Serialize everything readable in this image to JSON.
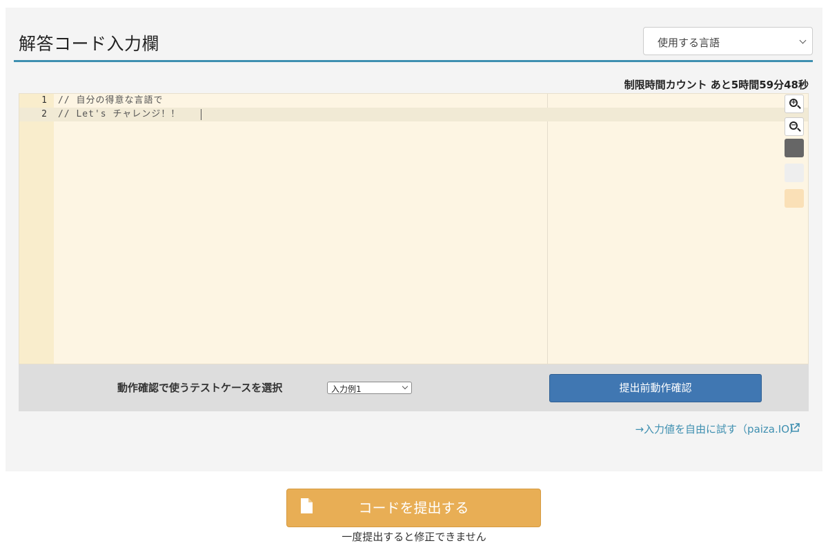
{
  "header": {
    "title": "解答コード入力欄",
    "language_select": "使用する言語"
  },
  "timer": {
    "text": "制限時間カウント あと5時間59分48秒"
  },
  "editor": {
    "lines": [
      {
        "num": "1",
        "text": "// 自分の得意な言語で"
      },
      {
        "num": "2",
        "text": "// Let's チャレンジ！！"
      }
    ],
    "tools": [
      "zoom-in-icon",
      "zoom-out-icon",
      "theme-dark",
      "theme-light",
      "theme-cream"
    ],
    "background": "#fdf5e3"
  },
  "testcase": {
    "label": "動作確認で使うテストケースを選択",
    "selected": "入力例1",
    "button": "提出前動作確認"
  },
  "links": {
    "paiza_io": "→入力値を自由に試す（paiza.IO）"
  },
  "submit": {
    "button": "コードを提出する",
    "note": "一度提出すると修正できません"
  },
  "colors": {
    "accent": "#3e8fb0",
    "primary_button": "#4077b2",
    "submit_button": "#e8ae55"
  }
}
